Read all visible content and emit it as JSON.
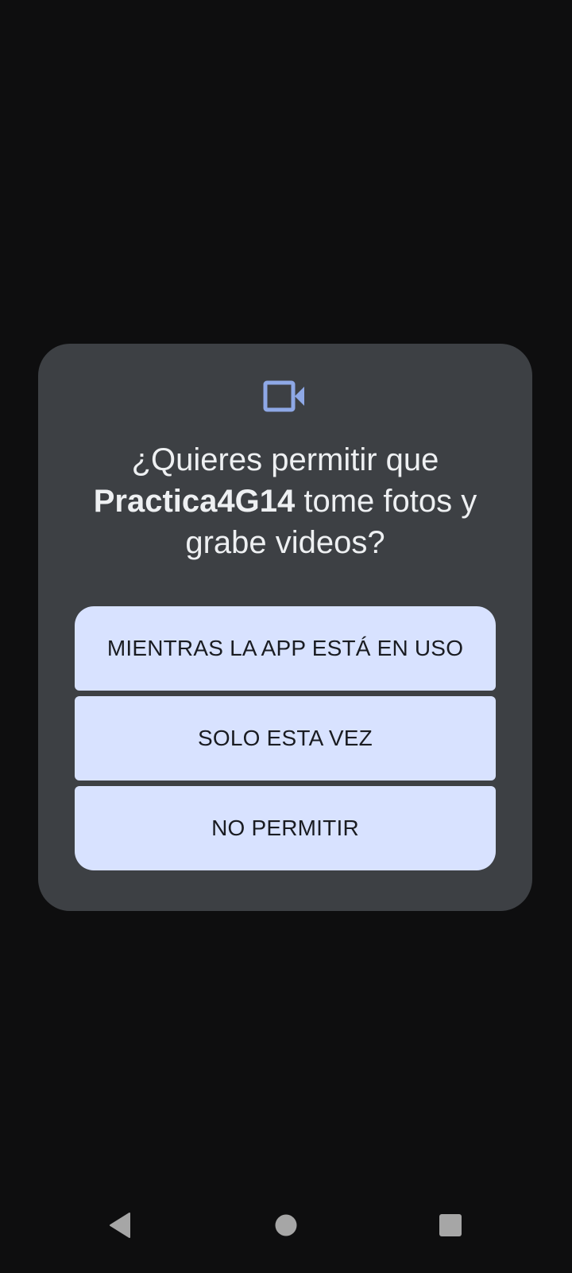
{
  "dialog": {
    "icon": "videocam-icon",
    "title_prefix": "¿Quieres permitir que ",
    "app_name": "Practica4G14",
    "title_suffix": " tome fotos y grabe videos?",
    "buttons": [
      {
        "label": "MIENTRAS LA APP ESTÁ EN USO"
      },
      {
        "label": "SOLO ESTA VEZ"
      },
      {
        "label": "NO PERMITIR"
      }
    ]
  },
  "navbar": {
    "back_icon": "back-triangle-icon",
    "home_icon": "home-circle-icon",
    "recents_icon": "recents-square-icon"
  },
  "colors": {
    "background": "#0e0e0f",
    "dialog": "#3d4044",
    "button": "#d8e2ff",
    "accent_icon": "#8ea8e6",
    "nav_icons": "#a6a6a6"
  }
}
